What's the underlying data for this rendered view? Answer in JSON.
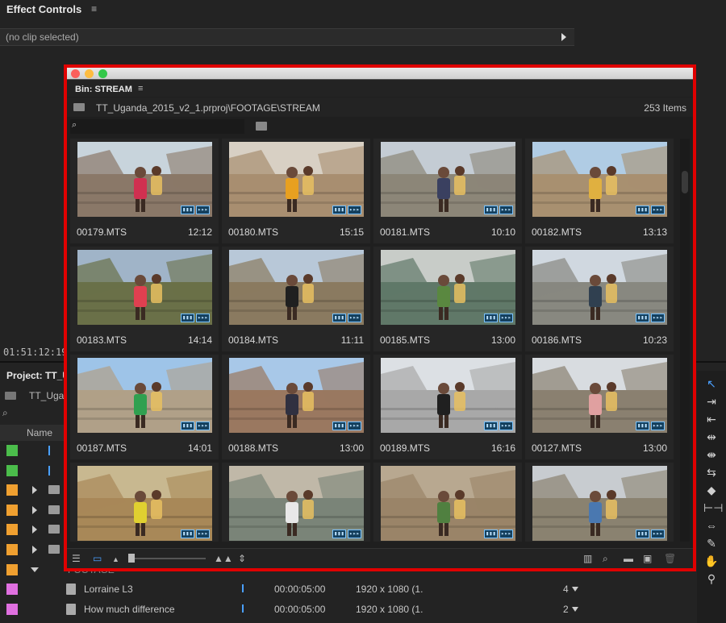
{
  "effect_controls": {
    "title": "Effect Controls",
    "menu_icon": "≡",
    "no_clip": "(no clip selected)",
    "timecode": "01:51:12:19"
  },
  "project": {
    "title": "Project: TT_U",
    "path": "TT_Uga",
    "column_name": "Name",
    "rows": [
      {
        "color": "#4bbd4b",
        "kind": "sequence",
        "name": "",
        "duration": "",
        "size": "",
        "count": ""
      },
      {
        "color": "#4bbd4b",
        "kind": "sequence",
        "name": "",
        "duration": "",
        "size": "",
        "count": ""
      },
      {
        "color": "#f0a030",
        "kind": "folder",
        "name": "",
        "duration": "",
        "size": "",
        "count": ""
      },
      {
        "color": "#f0a030",
        "kind": "folder",
        "name": "",
        "duration": "",
        "size": "",
        "count": ""
      },
      {
        "color": "#f0a030",
        "kind": "folder",
        "name": "",
        "duration": "",
        "size": "",
        "count": ""
      },
      {
        "color": "#f0a030",
        "kind": "folder",
        "name": "",
        "duration": "",
        "size": "",
        "count": ""
      },
      {
        "color": "#f0a030",
        "kind": "folder-open",
        "name": "FOOTAGE",
        "duration": "",
        "size": "",
        "count": ""
      },
      {
        "color": "#e070e0",
        "kind": "clip",
        "name": "Lorraine L3",
        "duration": "00:00:05:00",
        "size": "1920 x 1080 (1.",
        "count": "4"
      },
      {
        "color": "#e070e0",
        "kind": "clip",
        "name": "How much difference",
        "duration": "00:00:05:00",
        "size": "1920 x 1080 (1.",
        "count": "2"
      }
    ]
  },
  "bin": {
    "title": "Bin: STREAM",
    "menu_icon": "≡",
    "path": "TT_Uganda_2015_v2_1.prproj\\FOOTAGE\\STREAM",
    "count": "253 Items",
    "badge_video": "▮▮▮",
    "badge_audio": "▸▸▸",
    "clips": [
      {
        "name": "00179.MTS",
        "duration": "12:12",
        "sky": "#c8d4dc",
        "ground": "#8a7868",
        "accent": "#d03050"
      },
      {
        "name": "00180.MTS",
        "duration": "15:15",
        "sky": "#d8d0c4",
        "ground": "#a88e70",
        "accent": "#e8a020"
      },
      {
        "name": "00181.MTS",
        "duration": "10:10",
        "sky": "#c4ccd4",
        "ground": "#8c8678",
        "accent": "#3a4060"
      },
      {
        "name": "00182.MTS",
        "duration": "13:13",
        "sky": "#b0cce4",
        "ground": "#a89070",
        "accent": "#e0b040"
      },
      {
        "name": "00183.MTS",
        "duration": "14:14",
        "sky": "#a0b4c8",
        "ground": "#6a7048",
        "accent": "#e04050"
      },
      {
        "name": "00184.MTS",
        "duration": "11:11",
        "sky": "#b8c8d8",
        "ground": "#8a7a60",
        "accent": "#202020"
      },
      {
        "name": "00185.MTS",
        "duration": "13:00",
        "sky": "#c8ccc8",
        "ground": "#607868",
        "accent": "#5a8840"
      },
      {
        "name": "00186.MTS",
        "duration": "10:23",
        "sky": "#d0d8e0",
        "ground": "#888880",
        "accent": "#304050"
      },
      {
        "name": "00187.MTS",
        "duration": "14:01",
        "sky": "#9ec4e8",
        "ground": "#b0a088",
        "accent": "#30a050"
      },
      {
        "name": "00188.MTS",
        "duration": "13:00",
        "sky": "#a8c8e8",
        "ground": "#9a7860",
        "accent": "#303040"
      },
      {
        "name": "00189.MTS",
        "duration": "16:16",
        "sky": "#dce0e4",
        "ground": "#a8a8a8",
        "accent": "#202020"
      },
      {
        "name": "00127.MTS",
        "duration": "13:00",
        "sky": "#d8dce0",
        "ground": "#8a8070",
        "accent": "#e0a0a0"
      },
      {
        "name": "",
        "duration": "",
        "sky": "#c8b890",
        "ground": "#a88858",
        "accent": "#e0d030"
      },
      {
        "name": "",
        "duration": "",
        "sky": "#c0b8a8",
        "ground": "#7a8478",
        "accent": "#e8e8e8"
      },
      {
        "name": "",
        "duration": "",
        "sky": "#b8a890",
        "ground": "#9a8468",
        "accent": "#508040"
      },
      {
        "name": "",
        "duration": "",
        "sky": "#c8ccd0",
        "ground": "#8a8270",
        "accent": "#4a78b0"
      }
    ]
  },
  "colors": {
    "accent_blue": "#4aa0ff",
    "highlight_red": "#e00000",
    "light_close": "#fc605c",
    "light_min": "#fdbc40",
    "light_max": "#34c84a"
  },
  "icons": {
    "selection": "selection-icon",
    "track_select": "track-select-icon",
    "ripple": "ripple-edit-icon",
    "rolling": "rolling-edit-icon",
    "rate": "rate-stretch-icon",
    "razor": "razor-icon",
    "slip": "slip-icon",
    "slide": "slide-icon",
    "pen": "pen-icon",
    "hand": "hand-icon",
    "zoom": "zoom-icon"
  }
}
